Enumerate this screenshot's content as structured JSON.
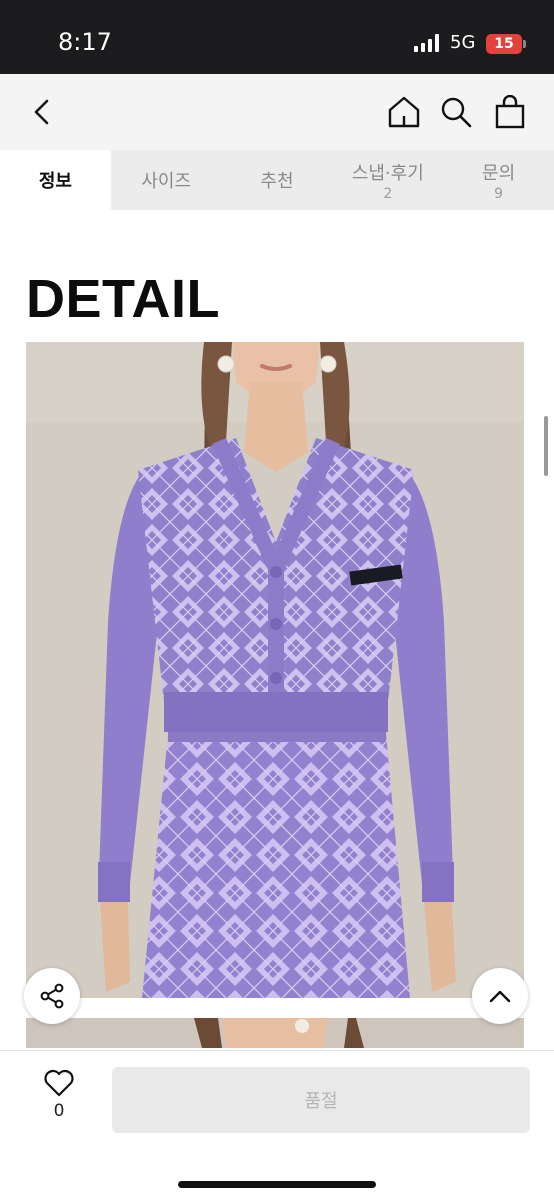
{
  "status_bar": {
    "time": "8:17",
    "network": "5G",
    "battery": "15"
  },
  "nav": {
    "icons": [
      "back-arrow-icon",
      "home-icon",
      "search-icon",
      "shopping-bag-icon"
    ]
  },
  "tabs": [
    {
      "label": "정보",
      "count": ""
    },
    {
      "label": "사이즈",
      "count": ""
    },
    {
      "label": "추천",
      "count": ""
    },
    {
      "label": "스냅·후기",
      "count": "2"
    },
    {
      "label": "문의",
      "count": "9"
    }
  ],
  "section_title": "DETAIL",
  "product_image": {
    "description_colors": {
      "background": "#d2cbc2",
      "knit": "#8d7ec9",
      "pattern_light": "#cfc1ee"
    }
  },
  "floating": {
    "share_icon": "share-icon",
    "top_icon": "chevron-up-icon"
  },
  "bottom_bar": {
    "like_count": "0",
    "action_label": "품절"
  }
}
